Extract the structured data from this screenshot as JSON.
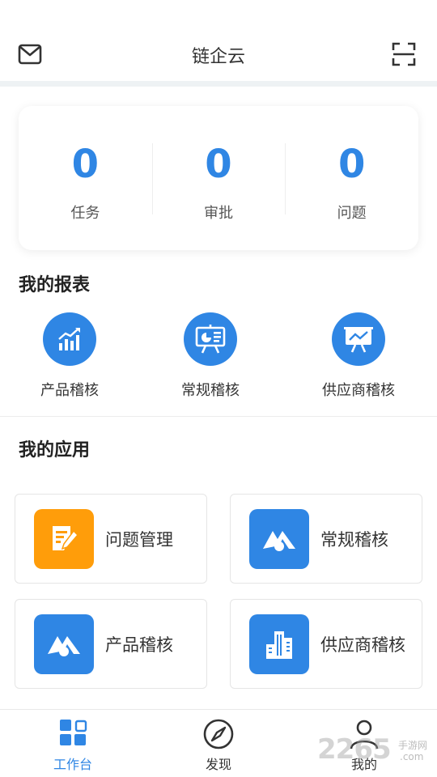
{
  "header": {
    "title": "链企云",
    "left_icon": "mail-icon",
    "right_icon": "scan-icon"
  },
  "stats": [
    {
      "value": "0",
      "label": "任务"
    },
    {
      "value": "0",
      "label": "审批"
    },
    {
      "value": "0",
      "label": "问题"
    }
  ],
  "reports": {
    "title": "我的报表",
    "items": [
      {
        "label": "产品稽核",
        "icon": "bar-chart-icon"
      },
      {
        "label": "常规稽核",
        "icon": "presentation-board-icon"
      },
      {
        "label": "供应商稽核",
        "icon": "trend-board-icon"
      }
    ]
  },
  "apps": {
    "title": "我的应用",
    "items": [
      {
        "label": "问题管理",
        "icon": "edit-note-icon",
        "color": "#ff9d0a"
      },
      {
        "label": "常规稽核",
        "icon": "mountain-logo-icon",
        "color": "#2f86e4"
      },
      {
        "label": "产品稽核",
        "icon": "mountain-logo-icon",
        "color": "#2f86e4"
      },
      {
        "label": "供应商稽核",
        "icon": "buildings-icon",
        "color": "#2f86e4"
      }
    ]
  },
  "tabbar": {
    "items": [
      {
        "label": "工作台",
        "icon": "grid-icon",
        "active": true
      },
      {
        "label": "发现",
        "icon": "compass-icon",
        "active": false
      },
      {
        "label": "我的",
        "icon": "user-icon",
        "active": false
      }
    ]
  },
  "watermark": {
    "brand": "2265",
    "sub": "手游网",
    "domain": ".com"
  },
  "colors": {
    "accent": "#2f86e4",
    "orange": "#ff9d0a"
  }
}
